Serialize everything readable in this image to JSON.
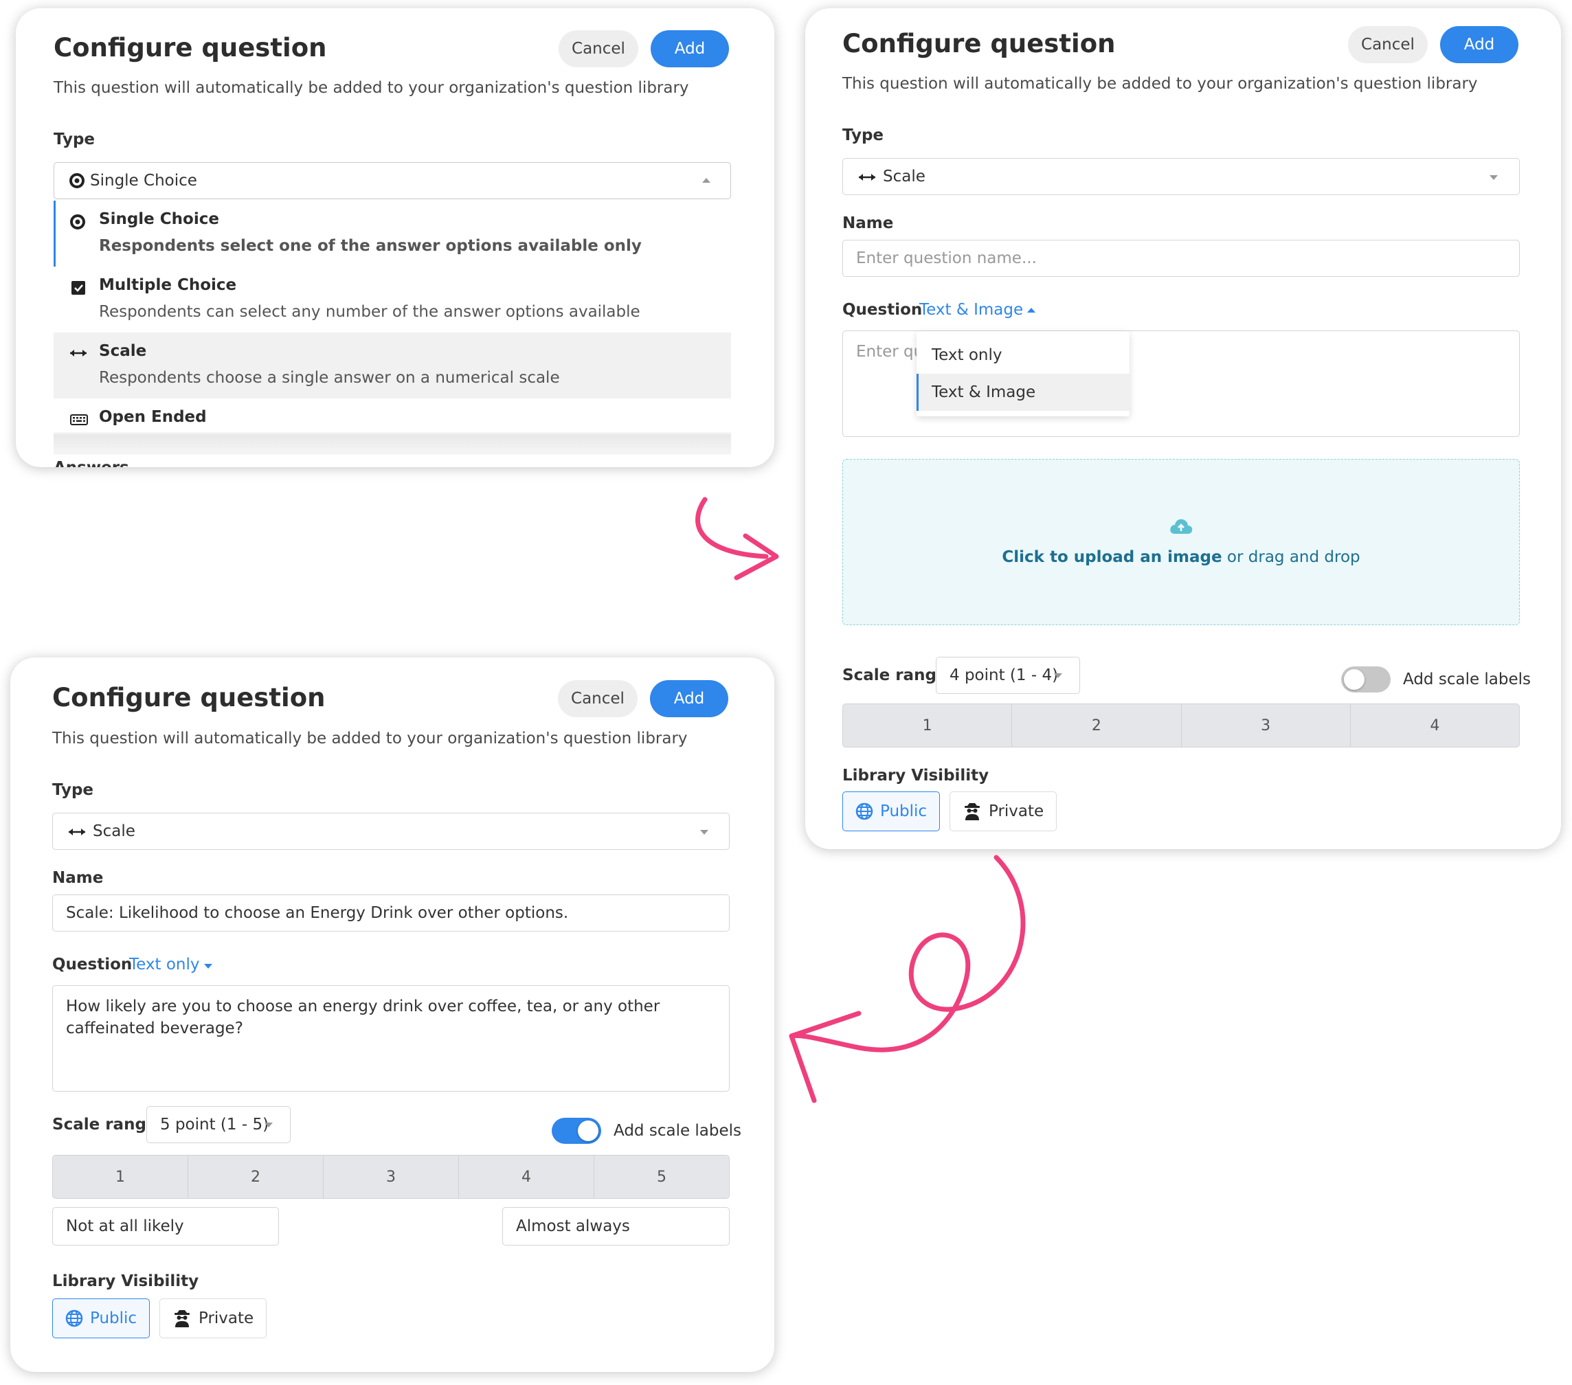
{
  "dialog": {
    "title": "Configure question",
    "subtitle": "This question will automatically be added to your organization's question library",
    "cancel_label": "Cancel",
    "add_label": "Add",
    "type_label": "Type",
    "name_label": "Name",
    "question_label": "Question",
    "scale_range_label": "Scale range",
    "add_scale_labels": "Add scale labels",
    "library_visibility_label": "Library Visibility",
    "public_label": "Public",
    "private_label": "Private"
  },
  "panel1": {
    "type_value": "Single Choice",
    "type_options": [
      {
        "title": "Single Choice",
        "description": "Respondents select one of the answer options available only",
        "icon": "radio-icon",
        "state": "selected"
      },
      {
        "title": "Multiple Choice",
        "description": "Respondents can select any number of the answer options available",
        "icon": "checkbox-icon",
        "state": "normal"
      },
      {
        "title": "Scale",
        "description": "Respondents choose a single answer on a numerical scale",
        "icon": "double-arrow-icon",
        "state": "hover"
      },
      {
        "title": "Open Ended",
        "description": "",
        "icon": "keyboard-icon",
        "state": "normal"
      }
    ],
    "cutoff_label": "Answers"
  },
  "panel2": {
    "type_value": "Scale",
    "name_placeholder": "Enter question name...",
    "question_mode": "Text & Image",
    "question_placeholder": "Enter qu",
    "mode_options": [
      "Text only",
      "Text & Image"
    ],
    "mode_selected": "Text & Image",
    "upload_link": "Click to upload an image",
    "upload_rest": " or drag and drop",
    "scale_range_value": "4 point (1 - 4)",
    "scale_values": [
      "1",
      "2",
      "3",
      "4"
    ],
    "scale_labels_enabled": false,
    "visibility_selected": "Public"
  },
  "panel3": {
    "type_value": "Scale",
    "name_value": "Scale: Likelihood to choose an Energy Drink over other options.",
    "question_mode": "Text only",
    "question_text": "How likely are you to choose an energy drink over coffee, tea, or any other caffeinated beverage?",
    "scale_range_value": "5 point (1 - 5)",
    "scale_values": [
      "1",
      "2",
      "3",
      "4",
      "5"
    ],
    "scale_labels_enabled": true,
    "min_label": "Not at all likely",
    "max_label": "Almost always",
    "visibility_selected": "Public"
  },
  "colors": {
    "accent": "#2f86eb",
    "arrow": "#ef3f7c",
    "upload_bg": "#ecf8f9",
    "upload_link": "#1d6f91"
  }
}
